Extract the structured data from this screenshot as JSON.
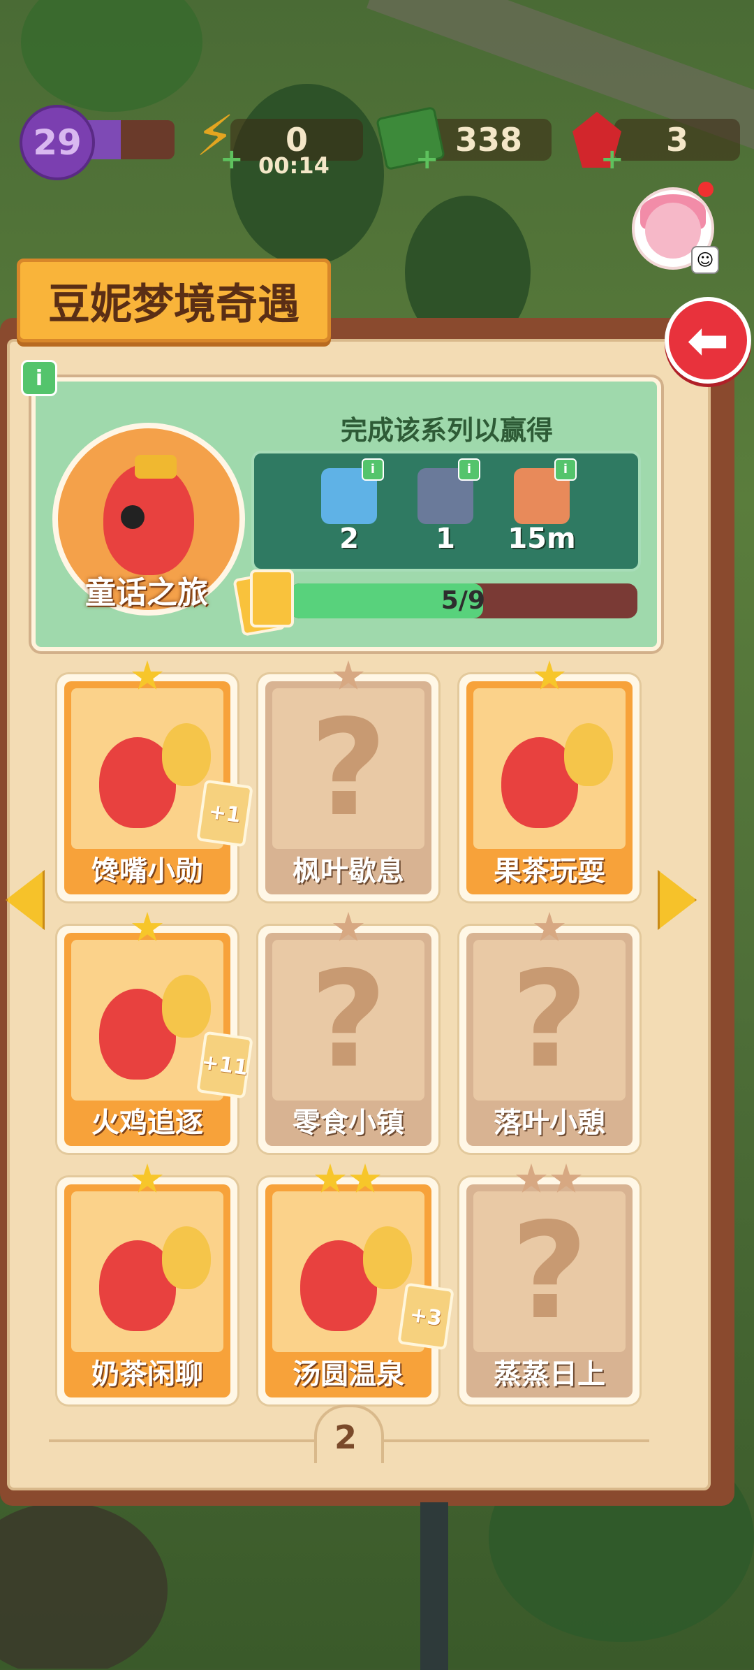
{
  "hud": {
    "level": "29",
    "level_progress": 0.45,
    "energy": "0",
    "energy_timer": "00:14",
    "cash": "338",
    "gems": "3",
    "bolt_icon": "lightning-icon",
    "cash_icon": "cash-stack-icon",
    "gem_icon": "ruby-icon"
  },
  "panel": {
    "title": "豆妮梦境奇遇",
    "back_icon": "back-arrow-icon"
  },
  "series": {
    "name": "童话之旅",
    "reward_caption": "完成该系列以赢得",
    "rewards": [
      {
        "icon": "energy-bottle-icon",
        "value": "2",
        "color": "#5fb2e6"
      },
      {
        "icon": "cash-safe-icon",
        "value": "1",
        "color": "#6a7a9a"
      },
      {
        "icon": "hourglass-icon",
        "value": "15m",
        "color": "#e88a5a"
      }
    ],
    "progress_text": "5/9",
    "progress": 0.5556
  },
  "cards": [
    {
      "label": "馋嘴小勋",
      "stars": 1,
      "unlocked": true,
      "badge": "+1"
    },
    {
      "label": "枫叶歇息",
      "stars": 1,
      "unlocked": false,
      "badge": ""
    },
    {
      "label": "果茶玩耍",
      "stars": 1,
      "unlocked": true,
      "badge": ""
    },
    {
      "label": "火鸡追逐",
      "stars": 1,
      "unlocked": true,
      "badge": "+11"
    },
    {
      "label": "零食小镇",
      "stars": 1,
      "unlocked": false,
      "badge": ""
    },
    {
      "label": "落叶小憩",
      "stars": 1,
      "unlocked": false,
      "badge": ""
    },
    {
      "label": "奶茶闲聊",
      "stars": 1,
      "unlocked": true,
      "badge": ""
    },
    {
      "label": "汤圆温泉",
      "stars": 2,
      "unlocked": true,
      "badge": "+3"
    },
    {
      "label": "蒸蒸日上",
      "stars": 2,
      "unlocked": false,
      "badge": ""
    }
  ],
  "pagination": {
    "page": "2"
  },
  "colors": {
    "accent": "#f9b43a",
    "panel": "#8a4a2e",
    "back": "#e8323c",
    "progress": "#58d27c"
  }
}
